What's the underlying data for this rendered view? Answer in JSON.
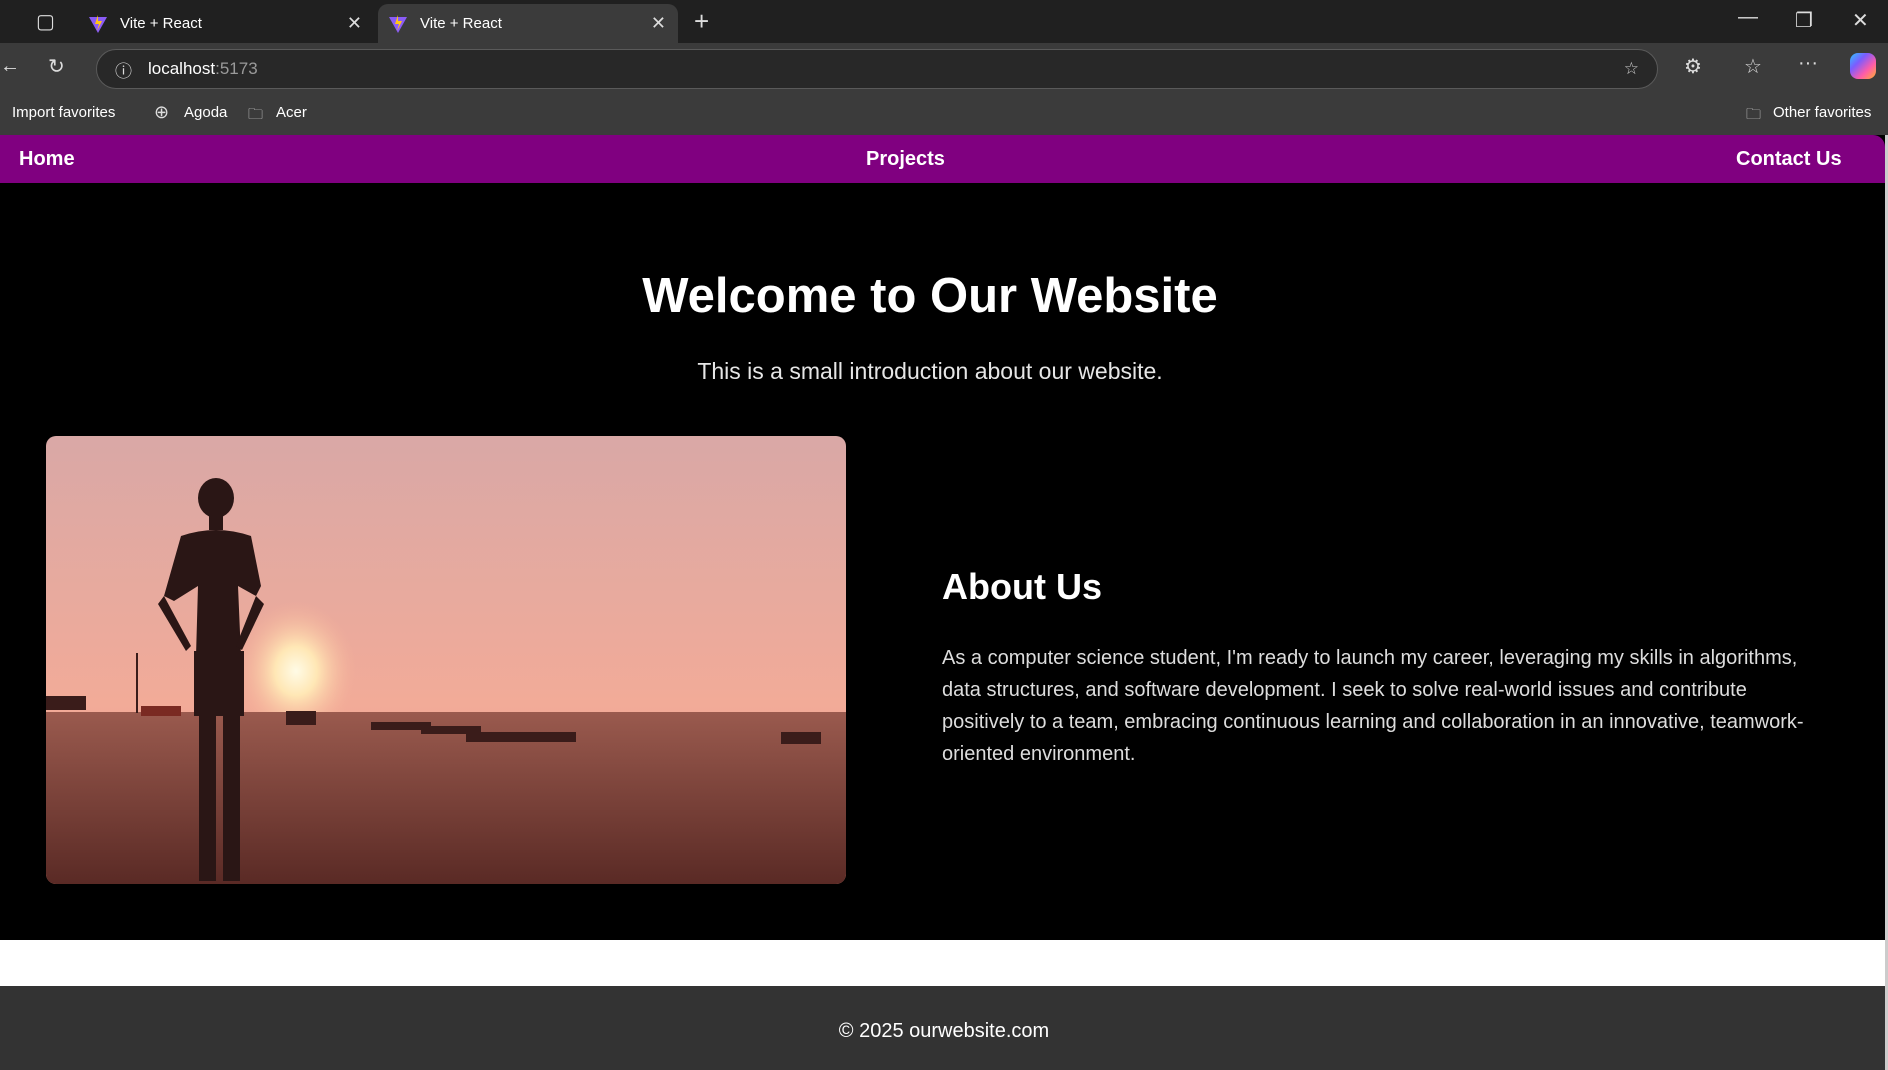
{
  "browser": {
    "tabs": [
      {
        "title": "Vite + React"
      },
      {
        "title": "Vite + React"
      }
    ],
    "address": {
      "host": "localhost",
      "port": ":5173"
    },
    "bookmarks": [
      "Import favorites",
      "Agoda",
      "Acer"
    ],
    "other_favorites": "Other favorites"
  },
  "nav": {
    "home": "Home",
    "projects": "Projects",
    "contact": "Contact Us",
    "color": "#800080"
  },
  "hero": {
    "title": "Welcome to Our Website",
    "subtitle": "This is a small introduction about our website."
  },
  "about": {
    "heading": "About Us",
    "text": "As a computer science student, I'm ready to launch my career, leveraging my skills in algorithms, data structures, and software development. I seek to solve real-world issues and contribute positively to a team, embracing continuous learning and collaboration in an innovative, teamwork-oriented environment."
  },
  "footer": {
    "text": "© 2025 ourwebsite.com"
  }
}
